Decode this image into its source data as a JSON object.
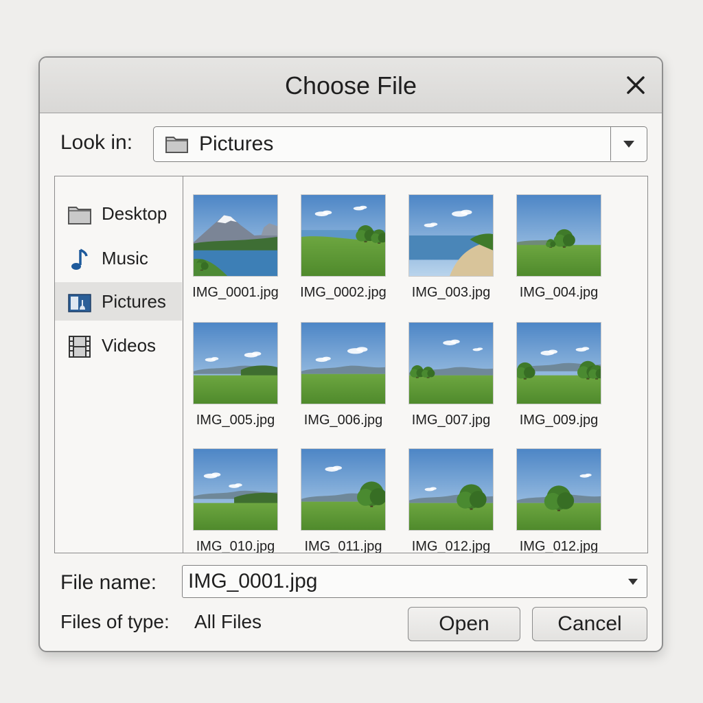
{
  "dialog": {
    "title": "Choose File",
    "close_icon": "close-icon"
  },
  "look_in": {
    "label": "Look in:",
    "value": "Pictures",
    "icon": "folder-icon"
  },
  "sidebar": {
    "items": [
      {
        "label": "Desktop",
        "icon": "folder-icon",
        "active": false
      },
      {
        "label": "Music",
        "icon": "music-note-icon",
        "active": false
      },
      {
        "label": "Pictures",
        "icon": "pictures-icon",
        "active": true
      },
      {
        "label": "Videos",
        "icon": "film-icon",
        "active": false
      }
    ]
  },
  "files": [
    {
      "name": "IMG_0001.jpg",
      "scene": "mountain-lake"
    },
    {
      "name": "IMG_0002.jpg",
      "scene": "grass-lake"
    },
    {
      "name": "IMG_003.jpg",
      "scene": "beach"
    },
    {
      "name": "IMG_004.jpg",
      "scene": "field-tree"
    },
    {
      "name": "IMG_005.jpg",
      "scene": "field-hill"
    },
    {
      "name": "IMG_006.jpg",
      "scene": "field"
    },
    {
      "name": "IMG_007.jpg",
      "scene": "field-trees-left"
    },
    {
      "name": "IMG_009.jpg",
      "scene": "field-trees-both"
    },
    {
      "name": "IMG_010.jpg",
      "scene": "field-hills"
    },
    {
      "name": "IMG_011.jpg",
      "scene": "field-big-tree-right"
    },
    {
      "name": "IMG_012.jpg",
      "scene": "field-big-tree-center"
    },
    {
      "name": "IMG_012.jpg",
      "scene": "field-big-tree-center-2"
    }
  ],
  "file_name": {
    "label": "File name:",
    "value": "IMG_0001.jpg"
  },
  "file_type": {
    "label": "Files of type:",
    "value": "All Files"
  },
  "buttons": {
    "open": "Open",
    "cancel": "Cancel"
  }
}
